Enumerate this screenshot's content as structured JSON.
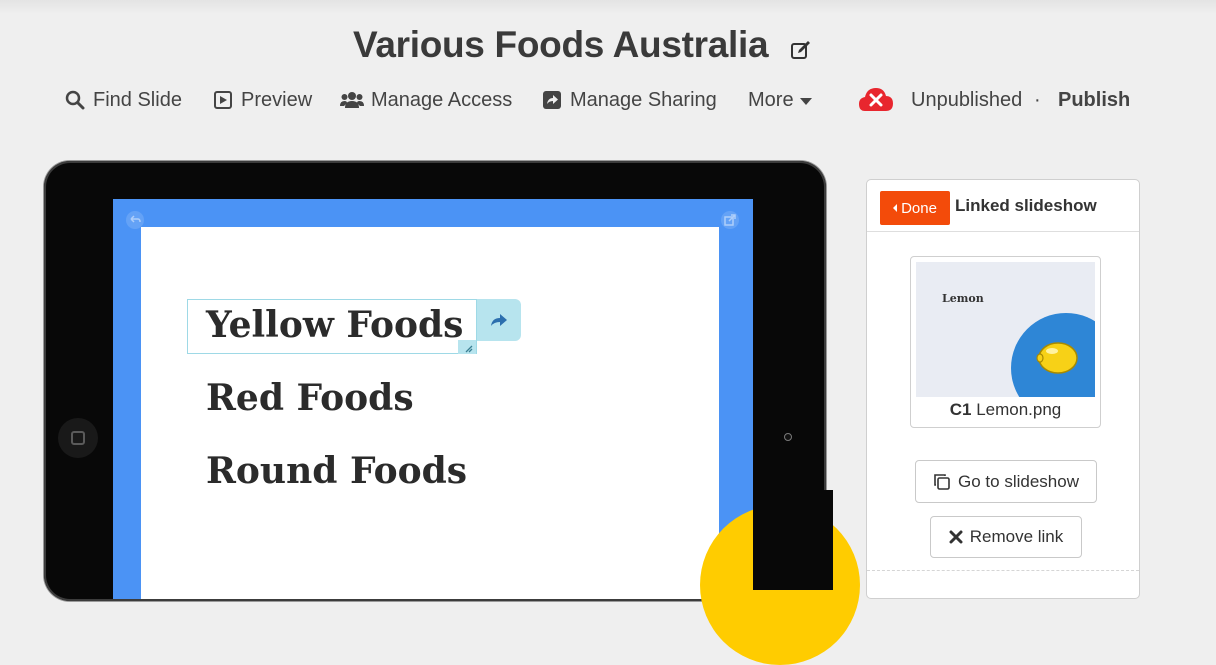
{
  "header": {
    "title": "Various Foods Australia",
    "edit_icon": "edit-icon"
  },
  "toolbar": {
    "find_slide": "Find Slide",
    "preview": "Preview",
    "manage_access": "Manage Access",
    "manage_sharing": "Manage Sharing",
    "more": "More",
    "status": "Unpublished",
    "separator": "·",
    "publish": "Publish",
    "status_color": "#e8262e"
  },
  "slide": {
    "items": [
      {
        "label": "Yellow Foods"
      },
      {
        "label": "Red Foods"
      },
      {
        "label": "Round Foods"
      }
    ],
    "background_color": "#4b93f5",
    "accent_color": "#ffcc00"
  },
  "panel": {
    "done_label": "Done",
    "title": "Linked slideshow",
    "thumbnail": {
      "slide_text": "Lemon",
      "code": "C1",
      "filename": "Lemon.png"
    },
    "goto_label": "Go to slideshow",
    "remove_label": "Remove link",
    "done_color": "#f34b0a"
  }
}
